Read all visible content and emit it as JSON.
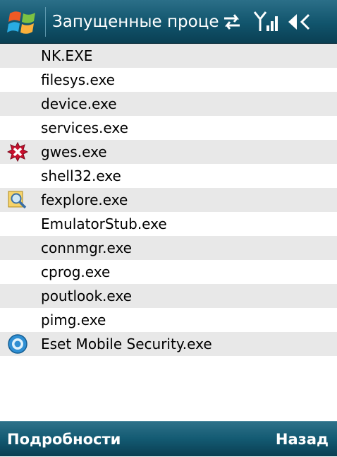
{
  "titlebar": {
    "title": "Запущенные процес",
    "icons": [
      "windows-start-icon",
      "sync-arrows-icon",
      "signal-strength-icon",
      "volume-muted-icon"
    ]
  },
  "processes": [
    {
      "name": "NK.EXE",
      "icon": null
    },
    {
      "name": "filesys.exe",
      "icon": null
    },
    {
      "name": "device.exe",
      "icon": null
    },
    {
      "name": "services.exe",
      "icon": null
    },
    {
      "name": "gwes.exe",
      "icon": "error-icon"
    },
    {
      "name": "shell32.exe",
      "icon": null
    },
    {
      "name": "fexplore.exe",
      "icon": "file-explorer-icon"
    },
    {
      "name": "EmulatorStub.exe",
      "icon": null
    },
    {
      "name": "connmgr.exe",
      "icon": null
    },
    {
      "name": "cprog.exe",
      "icon": null
    },
    {
      "name": "poutlook.exe",
      "icon": null
    },
    {
      "name": "pimg.exe",
      "icon": null
    },
    {
      "name": "Eset Mobile Security.exe",
      "icon": "eset-icon"
    }
  ],
  "softkeys": {
    "left": "Подробности",
    "right": "Назад"
  },
  "colors": {
    "bar_dark": "#0a3f53",
    "bar_light": "#2b6f88",
    "row_alt": "#e8e8e8"
  }
}
